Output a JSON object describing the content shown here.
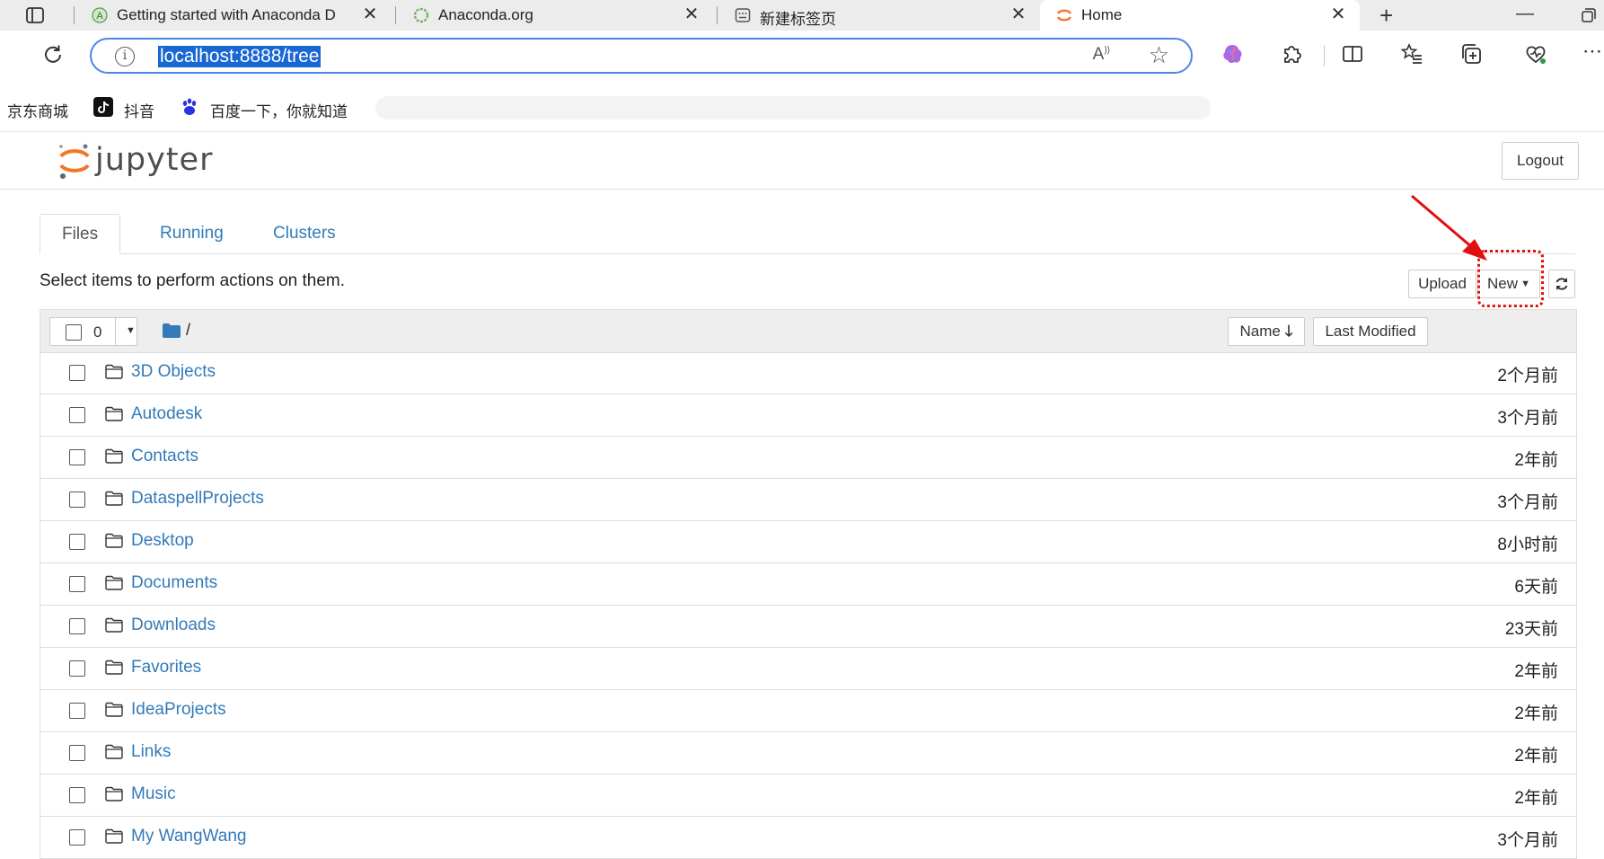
{
  "browser": {
    "tabs": [
      {
        "title": "Getting started with Anaconda D",
        "icon": "anaconda-a-icon"
      },
      {
        "title": "Anaconda.org",
        "icon": "anaconda-ring-icon"
      },
      {
        "title": "新建标签页",
        "icon": "newtab-page-icon"
      },
      {
        "title": "Home",
        "icon": "jupyter-icon",
        "active": true
      }
    ],
    "url": "localhost:8888/tree",
    "bookmarks": [
      {
        "label": "京东商城"
      },
      {
        "label": "抖音",
        "icon": "tiktok-icon"
      },
      {
        "label": "百度一下，你就知道",
        "icon": "baidu-paw-icon"
      }
    ]
  },
  "jupyter": {
    "brand": "jupyter",
    "logout_label": "Logout",
    "tabs": [
      "Files",
      "Running",
      "Clusters"
    ],
    "hint": "Select items to perform actions on them.",
    "upload_label": "Upload",
    "new_label": "New",
    "selected_count": "0",
    "breadcrumb": "/",
    "sort_name_label": "Name",
    "last_modified_label": "Last Modified",
    "items": [
      {
        "name": "3D Objects",
        "modified": "2个月前"
      },
      {
        "name": "Autodesk",
        "modified": "3个月前"
      },
      {
        "name": "Contacts",
        "modified": "2年前"
      },
      {
        "name": "DataspellProjects",
        "modified": "3个月前"
      },
      {
        "name": "Desktop",
        "modified": "8小时前"
      },
      {
        "name": "Documents",
        "modified": "6天前"
      },
      {
        "name": "Downloads",
        "modified": "23天前"
      },
      {
        "name": "Favorites",
        "modified": "2年前"
      },
      {
        "name": "IdeaProjects",
        "modified": "2年前"
      },
      {
        "name": "Links",
        "modified": "2年前"
      },
      {
        "name": "Music",
        "modified": "2年前"
      },
      {
        "name": "My WangWang",
        "modified": "3个月前"
      }
    ]
  },
  "colors": {
    "link": "#337ab7",
    "url_highlight": "#1967d2",
    "annotation": "#e01010",
    "jupyter_orange": "#f37726"
  }
}
